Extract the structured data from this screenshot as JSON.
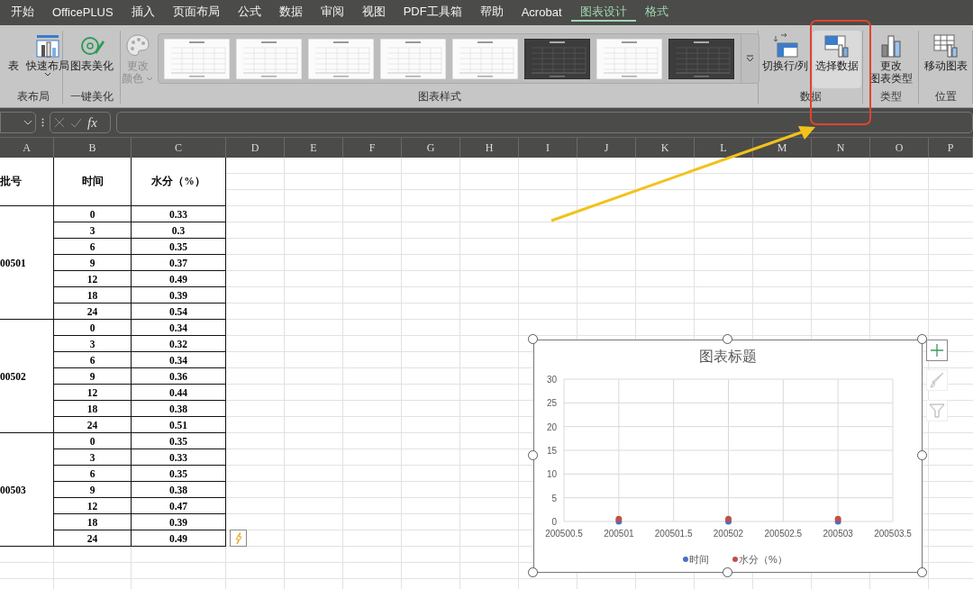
{
  "tabs": [
    {
      "label": "开始",
      "selected": false,
      "contextual": false
    },
    {
      "label": "OfficePLUS",
      "selected": false,
      "contextual": false
    },
    {
      "label": "插入",
      "selected": false,
      "contextual": false
    },
    {
      "label": "页面布局",
      "selected": false,
      "contextual": false
    },
    {
      "label": "公式",
      "selected": false,
      "contextual": false
    },
    {
      "label": "数据",
      "selected": false,
      "contextual": false
    },
    {
      "label": "审阅",
      "selected": false,
      "contextual": false
    },
    {
      "label": "视图",
      "selected": false,
      "contextual": false
    },
    {
      "label": "PDF工具箱",
      "selected": false,
      "contextual": false
    },
    {
      "label": "帮助",
      "selected": false,
      "contextual": false
    },
    {
      "label": "Acrobat",
      "selected": false,
      "contextual": false
    },
    {
      "label": "图表设计",
      "selected": true,
      "contextual": true
    },
    {
      "label": "格式",
      "selected": false,
      "contextual": true
    }
  ],
  "ribbon": {
    "groups": [
      {
        "label": "表布局",
        "buttons": [
          {
            "lines": [
              "表"
            ],
            "dropdown": false,
            "disabled": false,
            "hovered": false
          },
          {
            "lines": [
              "快速布局"
            ],
            "dropdown": true,
            "disabled": false,
            "hovered": false
          }
        ]
      },
      {
        "label": "一键美化",
        "buttons": [
          {
            "lines": [
              "图表美化"
            ],
            "dropdown": false,
            "disabled": false,
            "hovered": false
          }
        ]
      },
      {
        "label": "图表样式",
        "buttons": [
          {
            "lines": [
              "更改",
              "颜色"
            ],
            "dropdown": true,
            "disabled": true,
            "hovered": false
          }
        ],
        "gallery": [
          {
            "kind": "light"
          },
          {
            "kind": "light"
          },
          {
            "kind": "light"
          },
          {
            "kind": "light"
          },
          {
            "kind": "light"
          },
          {
            "kind": "dark"
          },
          {
            "kind": "light"
          },
          {
            "kind": "dark"
          }
        ]
      },
      {
        "label": "数据",
        "buttons": [
          {
            "lines": [
              "切换行/列"
            ],
            "dropdown": false,
            "disabled": false,
            "hovered": false
          },
          {
            "lines": [
              "选择数据"
            ],
            "dropdown": false,
            "disabled": false,
            "hovered": true
          }
        ]
      },
      {
        "label": "类型",
        "buttons": [
          {
            "lines": [
              "更改",
              "图表类型"
            ],
            "dropdown": false,
            "disabled": false,
            "hovered": false
          }
        ]
      },
      {
        "label": "位置",
        "buttons": [
          {
            "lines": [
              "移动图表"
            ],
            "dropdown": false,
            "disabled": false,
            "hovered": false
          }
        ]
      }
    ]
  },
  "formula_bar": {
    "function_label": "fx"
  },
  "sheet": {
    "columns": [
      "A",
      "B",
      "C",
      "D",
      "E",
      "F",
      "G",
      "H",
      "I",
      "J",
      "K",
      "L",
      "M",
      "N",
      "O",
      "P"
    ],
    "headers": [
      "批号",
      "时间",
      "水分（%）"
    ],
    "batches": [
      {
        "batch": "00501",
        "rows": [
          {
            "time": "0",
            "moisture": "0.33"
          },
          {
            "time": "3",
            "moisture": "0.3"
          },
          {
            "time": "6",
            "moisture": "0.35"
          },
          {
            "time": "9",
            "moisture": "0.37"
          },
          {
            "time": "12",
            "moisture": "0.49"
          },
          {
            "time": "18",
            "moisture": "0.39"
          },
          {
            "time": "24",
            "moisture": "0.54"
          }
        ]
      },
      {
        "batch": "00502",
        "rows": [
          {
            "time": "0",
            "moisture": "0.34"
          },
          {
            "time": "3",
            "moisture": "0.32"
          },
          {
            "time": "6",
            "moisture": "0.34"
          },
          {
            "time": "9",
            "moisture": "0.36"
          },
          {
            "time": "12",
            "moisture": "0.44"
          },
          {
            "time": "18",
            "moisture": "0.38"
          },
          {
            "time": "24",
            "moisture": "0.51"
          }
        ]
      },
      {
        "batch": "00503",
        "rows": [
          {
            "time": "0",
            "moisture": "0.35"
          },
          {
            "time": "3",
            "moisture": "0.33"
          },
          {
            "time": "6",
            "moisture": "0.35"
          },
          {
            "time": "9",
            "moisture": "0.38"
          },
          {
            "time": "12",
            "moisture": "0.47"
          },
          {
            "time": "18",
            "moisture": "0.39"
          },
          {
            "time": "24",
            "moisture": "0.49"
          }
        ]
      }
    ]
  },
  "chart": {
    "title": "图表标题",
    "chart_data": {
      "type": "scatter",
      "grid": true,
      "legend": true,
      "x": [
        200501,
        200502,
        200503
      ],
      "series": [
        {
          "name": "时间",
          "color": "#4472c4",
          "values": [
            0,
            0,
            0
          ]
        },
        {
          "name": "水分（%）",
          "color": "#c0504d",
          "values": [
            0.5,
            0.5,
            0.5
          ]
        }
      ],
      "xlim": [
        200500.5,
        200503.5
      ],
      "ylim": [
        0,
        30
      ],
      "xticks": [
        {
          "value": 200500.5,
          "label": "200500.5"
        },
        {
          "value": 200501,
          "label": "200501"
        },
        {
          "value": 200501.5,
          "label": "200501.5"
        },
        {
          "value": 200502,
          "label": "200502"
        },
        {
          "value": 200502.5,
          "label": "200502.5"
        },
        {
          "value": 200503,
          "label": "200503"
        },
        {
          "value": 200503.5,
          "label": "200503.5"
        }
      ],
      "yticks": [
        {
          "value": 0,
          "label": "0"
        },
        {
          "value": 5,
          "label": "5"
        },
        {
          "value": 10,
          "label": "10"
        },
        {
          "value": 15,
          "label": "15"
        },
        {
          "value": 20,
          "label": "20"
        },
        {
          "value": 25,
          "label": "25"
        },
        {
          "value": 30,
          "label": "30"
        }
      ]
    }
  }
}
